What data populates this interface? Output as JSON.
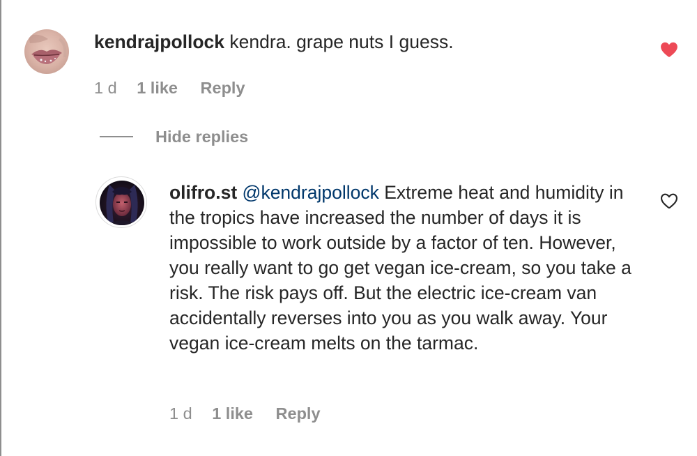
{
  "comments": [
    {
      "username": "kendrajpollock",
      "text": "kendra. grape nuts I guess.",
      "age": "1 d",
      "likes": "1 like",
      "reply_label": "Reply",
      "liked": true,
      "avatar_icon": "user-avatar-lips-photo"
    }
  ],
  "replies_toggle": {
    "label": "Hide replies"
  },
  "replies": [
    {
      "username": "olifro.st",
      "mention": "@kendrajpollock",
      "text": "Extreme heat and humidity in the tropics have increased the number of days it is impossible to work outside by a factor of ten. However, you really want to go get vegan ice-cream, so you take a risk. The risk pays off. But the electric ice-cream van accidentally reverses into you as you walk away. Your vegan ice-cream melts on the tarmac.",
      "age": "1 d",
      "likes": "1 like",
      "reply_label": "Reply",
      "liked": false,
      "avatar_icon": "user-avatar-dark-portrait-photo"
    }
  ],
  "colors": {
    "text": "#262626",
    "muted": "#8e8e8e",
    "mention": "#00376b",
    "heart_filled": "#ed4956",
    "heart_outline": "#262626"
  }
}
